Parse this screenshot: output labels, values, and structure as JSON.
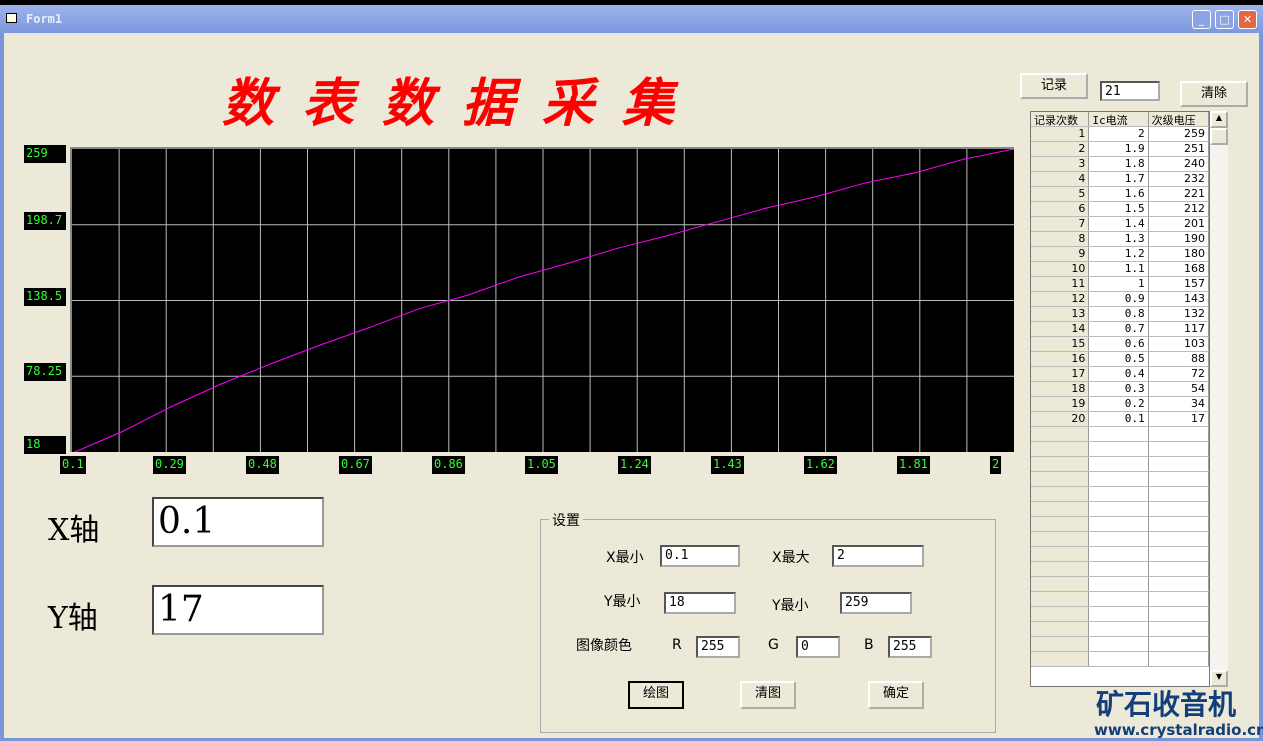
{
  "window": {
    "title": "Form1",
    "min": "_",
    "max": "□",
    "close": "✕"
  },
  "heading": "数表数据采集",
  "chart_data": {
    "type": "line",
    "title": "数表数据采集",
    "xlim": [
      0.1,
      2
    ],
    "ylim": [
      18,
      259
    ],
    "x_ticks": [
      "0.1",
      "0.29",
      "0.48",
      "0.67",
      "0.86",
      "1.05",
      "1.24",
      "1.43",
      "1.62",
      "1.81",
      "2"
    ],
    "y_ticks": [
      "259",
      "198.7",
      "138.5",
      "78.25",
      "18"
    ],
    "color": "#ff00ff",
    "x": [
      0.1,
      0.2,
      0.3,
      0.4,
      0.5,
      0.6,
      0.7,
      0.8,
      0.9,
      1,
      1.1,
      1.2,
      1.3,
      1.4,
      1.5,
      1.6,
      1.7,
      1.8,
      1.9,
      2
    ],
    "y": [
      17,
      34,
      54,
      72,
      88,
      103,
      117,
      132,
      143,
      157,
      168,
      180,
      190,
      201,
      212,
      221,
      232,
      240,
      251,
      259
    ]
  },
  "readout": {
    "x_label": "X轴",
    "x_value": "0.1",
    "y_label": "Y轴",
    "y_value": "17"
  },
  "settings": {
    "legend": "设置",
    "xmin_label": "X最小",
    "xmin": "0.1",
    "xmax_label": "X最大",
    "xmax": "2",
    "ymin_label": "Y最小",
    "ymin": "18",
    "ymax_label": "Y最小",
    "ymax": "259",
    "color_label": "图像颜色",
    "r_label": "R",
    "r": "255",
    "g_label": "G",
    "g": "0",
    "b_label": "B",
    "b": "255",
    "draw": "绘图",
    "clear": "清图",
    "ok": "确定"
  },
  "record": {
    "button": "记录",
    "count": "21",
    "clear": "清除"
  },
  "table": {
    "headers": [
      "记录次数",
      "Ic电流",
      "次级电压"
    ],
    "rows": [
      [
        "1",
        "2",
        "259"
      ],
      [
        "2",
        "1.9",
        "251"
      ],
      [
        "3",
        "1.8",
        "240"
      ],
      [
        "4",
        "1.7",
        "232"
      ],
      [
        "5",
        "1.6",
        "221"
      ],
      [
        "6",
        "1.5",
        "212"
      ],
      [
        "7",
        "1.4",
        "201"
      ],
      [
        "8",
        "1.3",
        "190"
      ],
      [
        "9",
        "1.2",
        "180"
      ],
      [
        "10",
        "1.1",
        "168"
      ],
      [
        "11",
        "1",
        "157"
      ],
      [
        "12",
        "0.9",
        "143"
      ],
      [
        "13",
        "0.8",
        "132"
      ],
      [
        "14",
        "0.7",
        "117"
      ],
      [
        "15",
        "0.6",
        "103"
      ],
      [
        "16",
        "0.5",
        "88"
      ],
      [
        "17",
        "0.4",
        "72"
      ],
      [
        "18",
        "0.3",
        "54"
      ],
      [
        "19",
        "0.2",
        "34"
      ],
      [
        "20",
        "0.1",
        "17"
      ]
    ]
  },
  "watermark": {
    "brand": "矿石收音机",
    "url": "www.crystalradio.cn"
  }
}
